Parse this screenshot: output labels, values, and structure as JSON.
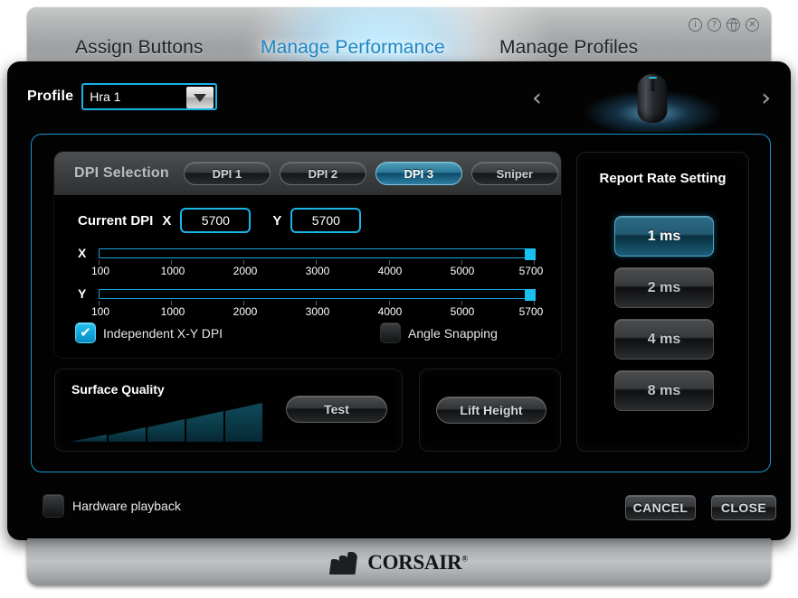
{
  "window": {
    "tools": [
      {
        "name": "info-icon",
        "glyph": "i"
      },
      {
        "name": "help-icon",
        "glyph": "?"
      },
      {
        "name": "globe-icon",
        "glyph": ""
      },
      {
        "name": "close-icon",
        "glyph": "✕"
      }
    ]
  },
  "tabs": [
    {
      "label": "Assign Buttons",
      "active": false
    },
    {
      "label": "Manage Performance",
      "active": true
    },
    {
      "label": "Manage Profiles",
      "active": false
    }
  ],
  "profile": {
    "label": "Profile",
    "value": "Hra 1",
    "prev_arrow": "‹",
    "next_arrow": "›"
  },
  "dpi": {
    "section_title": "DPI Selection",
    "presets": [
      {
        "label": "DPI 1",
        "selected": false
      },
      {
        "label": "DPI 2",
        "selected": false
      },
      {
        "label": "DPI 3",
        "selected": true
      },
      {
        "label": "Sniper",
        "selected": false
      }
    ],
    "current_label": "Current DPI",
    "x_letter": "X",
    "y_letter": "Y",
    "x_value": "5700",
    "y_value": "5700",
    "slider_x_label": "X",
    "slider_y_label": "Y",
    "tick_labels": [
      "100",
      "1000",
      "2000",
      "3000",
      "4000",
      "5000",
      "5700"
    ],
    "checkboxes": [
      {
        "label": "Independent X-Y DPI",
        "checked": true
      },
      {
        "label": "Angle Snapping",
        "checked": false
      }
    ]
  },
  "surface": {
    "title": "Surface Quality",
    "test_label": "Test",
    "lift_label": "Lift Height"
  },
  "report_rate": {
    "title": "Report Rate Setting",
    "options": [
      {
        "label": "1 ms",
        "selected": true
      },
      {
        "label": "2 ms",
        "selected": false
      },
      {
        "label": "4 ms",
        "selected": false
      },
      {
        "label": "8 ms",
        "selected": false
      }
    ]
  },
  "footer": {
    "hardware_playback_label": "Hardware playback",
    "hardware_playback_checked": false,
    "cancel_label": "CANCEL",
    "close_label": "CLOSE",
    "brand": "CORSAIR",
    "brand_mark": "®"
  },
  "colors": {
    "accent_cyan": "#19b4e8",
    "tab_active": "#1d87c4",
    "panel_bg": "#030303",
    "selected_teal": "#2b7797"
  }
}
